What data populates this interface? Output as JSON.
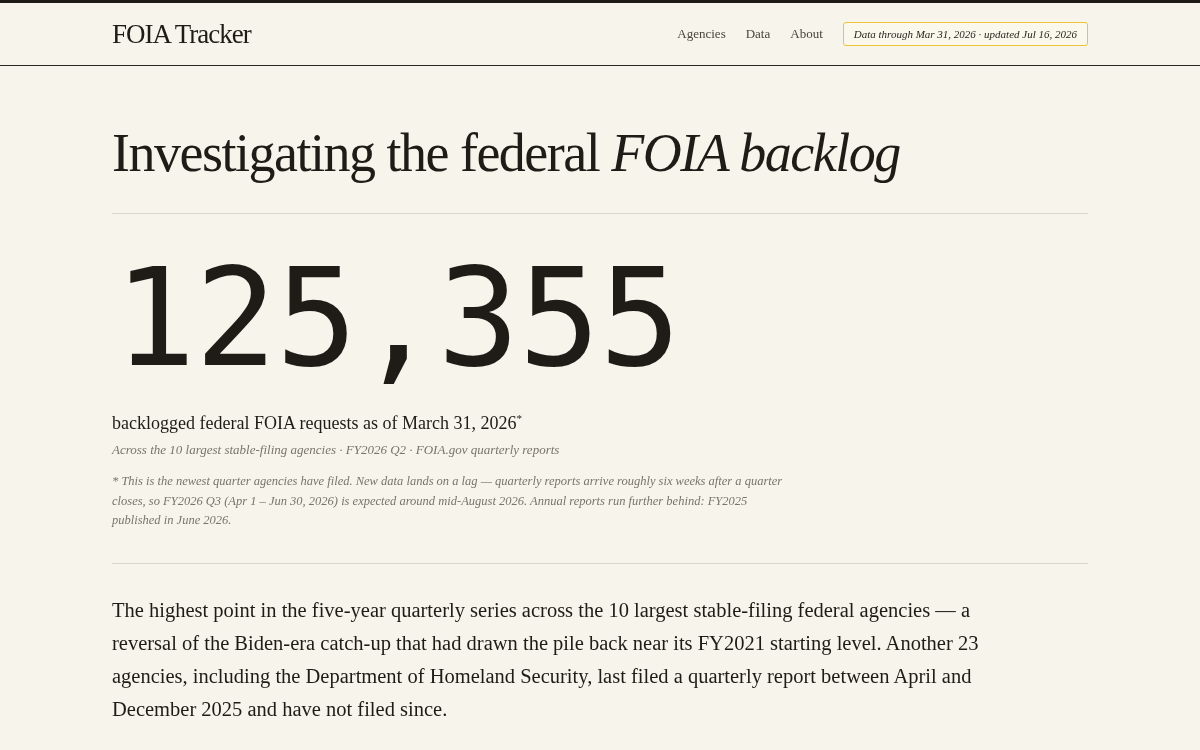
{
  "header": {
    "logo": "FOIA Tracker",
    "nav": [
      "Agencies",
      "Data",
      "About"
    ],
    "data_badge": "Data through Mar 31, 2026 · updated Jul 16, 2026"
  },
  "hero": {
    "title": "Investigating the federal *FOIA backlog*"
  },
  "stat": {
    "value": "125,355",
    "caption": "backlogged federal FOIA requests as of March 31, 2026$^{*}$",
    "source": "Across the 10 largest stable-filing agencies · FY2026 Q2 · FOIA.gov quarterly reports",
    "footnote": "* This is the newest quarter agencies have filed. New data lands on a lag — quarterly reports arrive roughly six weeks after a quarter closes, so FY2026 Q3 (Apr 1 – Jun 30, 2026) is expected around mid-August 2026. Annual reports run further behind: FY2025 published in June 2026."
  },
  "summary": "The highest point in the five-year quarterly series across the 10 largest stable-filing federal agencies — a reversal of the Biden-era catch-up that had drawn the pile back near its FY2021 starting level. Another 23 agencies, including the Department of Homeland Security, last filed a quarterly report between April and December 2025 and have not filed since."
}
